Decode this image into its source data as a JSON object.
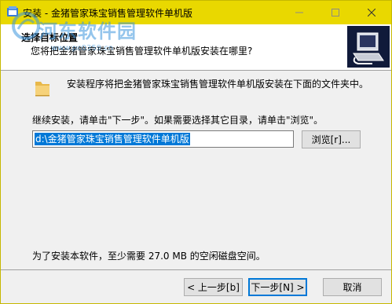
{
  "window": {
    "title": "安装 - 金猪管家珠宝销售管理软件单机版"
  },
  "header": {
    "title": "选择目标位置",
    "subtitle": "您将把金猪管家珠宝销售管理软件单机版安装在哪里?"
  },
  "watermark": {
    "text": "河东软件园",
    "url": "www.pc0359.cn"
  },
  "body": {
    "intro": "安装程序将把金猪管家珠宝销售管理软件单机版安装在下面的文件夹中。",
    "continue": "继续安装，请单击\"下一步\"。如果需要选择其它目录，请单击\"浏览\"。",
    "path_value": "d:\\金猪管家珠宝销售管理软件单机版",
    "browse_label": "浏览[r]...",
    "space_required": "为了安装本软件，至少需要 27.0 MB 的空闲磁盘空间。"
  },
  "footer": {
    "back_label": "< 上一步[b]",
    "next_label": "下一步[N] >",
    "cancel_label": "取消"
  },
  "colors": {
    "titlebar": "#e9d800",
    "selection": "#0078d7",
    "header_image_bg": "#101a3a"
  }
}
